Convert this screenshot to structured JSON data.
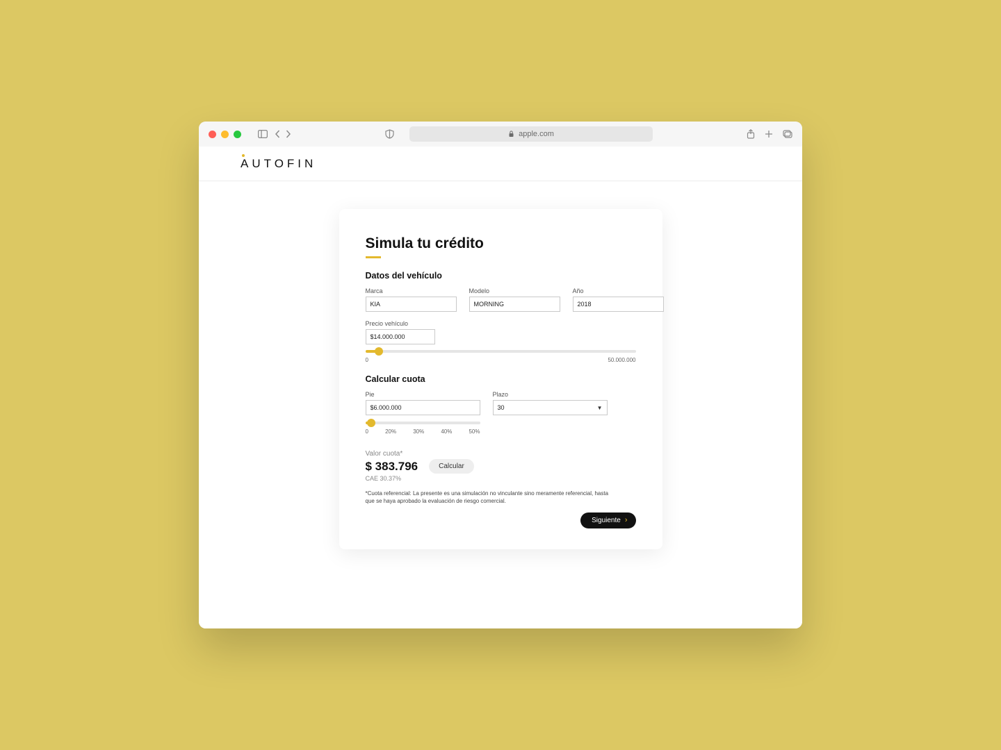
{
  "browser": {
    "url": "apple.com"
  },
  "brand": {
    "logo_text": "AUTOFIN",
    "accent": "#e3b92d"
  },
  "card": {
    "title": "Simula tu crédito",
    "section_vehicle": "Datos del vehículo",
    "marca_label": "Marca",
    "marca_value": "KIA",
    "modelo_label": "Modelo",
    "modelo_value": "MORNING",
    "ano_label": "Año",
    "ano_value": "2018",
    "precio_label": "Precio vehículo",
    "precio_value": "$14.000.000",
    "precio_min": "0",
    "precio_max": "50.000.000",
    "precio_percent": 5,
    "section_cuota": "Calcular cuota",
    "pie_label": "Pie",
    "pie_value": "$6.000.000",
    "pie_ticks": [
      "0",
      "20%",
      "30%",
      "40%",
      "50%"
    ],
    "pie_percent": 5,
    "plazo_label": "Plazo",
    "plazo_value": "30",
    "result_label": "Valor cuota*",
    "result_amount": "$ 383.796",
    "calc_label": "Calcular",
    "cae_text": "CAE 30.37%",
    "disclaimer": "*Cuota referencial: La presente es una simulación no vinculante sino meramente referencial, hasta que se haya aprobado la evaluación de riesgo comercial.",
    "next_label": "Siguiente"
  }
}
